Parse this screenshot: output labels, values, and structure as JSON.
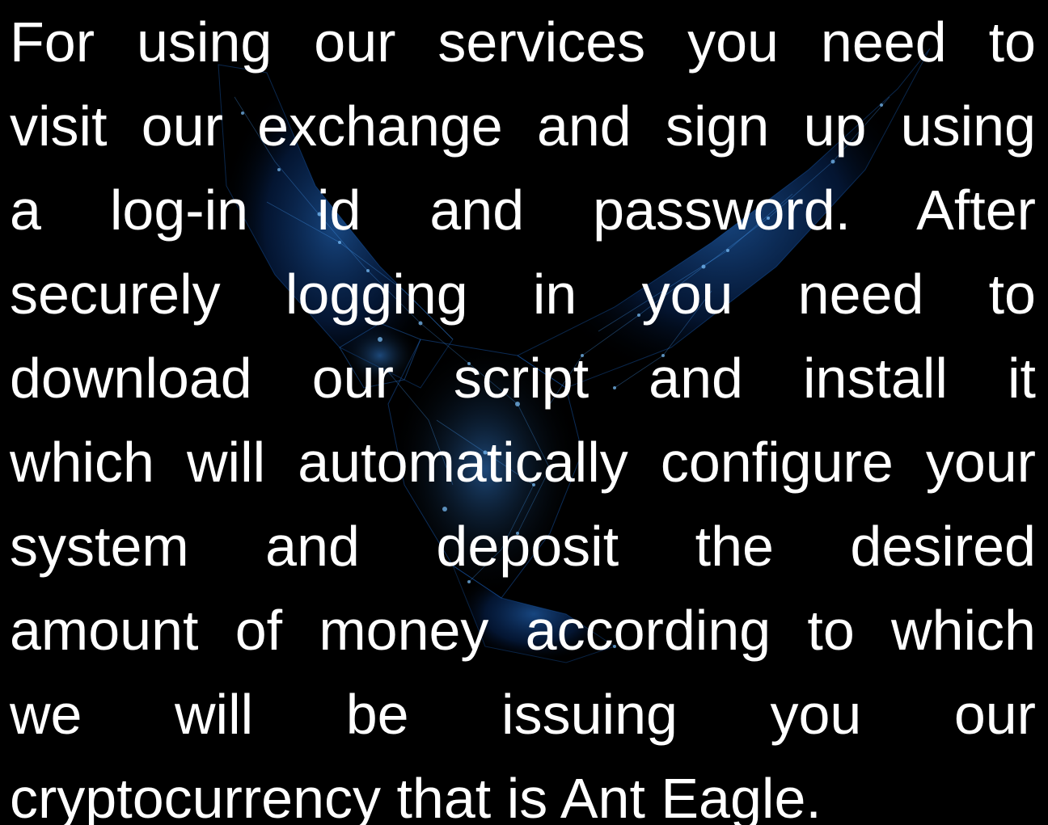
{
  "colors": {
    "background": "#000000",
    "text": "#ffffff",
    "eagle_glow": "#1e6fd9",
    "eagle_dots": "#7fc4ff"
  },
  "background_image": {
    "icon": "eagle-network-icon"
  },
  "paragraph": {
    "lines": [
      "For using our services you need to",
      "visit our exchange and sign up using",
      "a log-in id and password. After",
      "securely logging in you need to",
      "download our script and install it",
      "which will automatically configure your",
      "system and deposit the desired",
      "amount of money according to which",
      "we will be issuing you our",
      "cryptocurrency that is Ant Eagle."
    ]
  }
}
